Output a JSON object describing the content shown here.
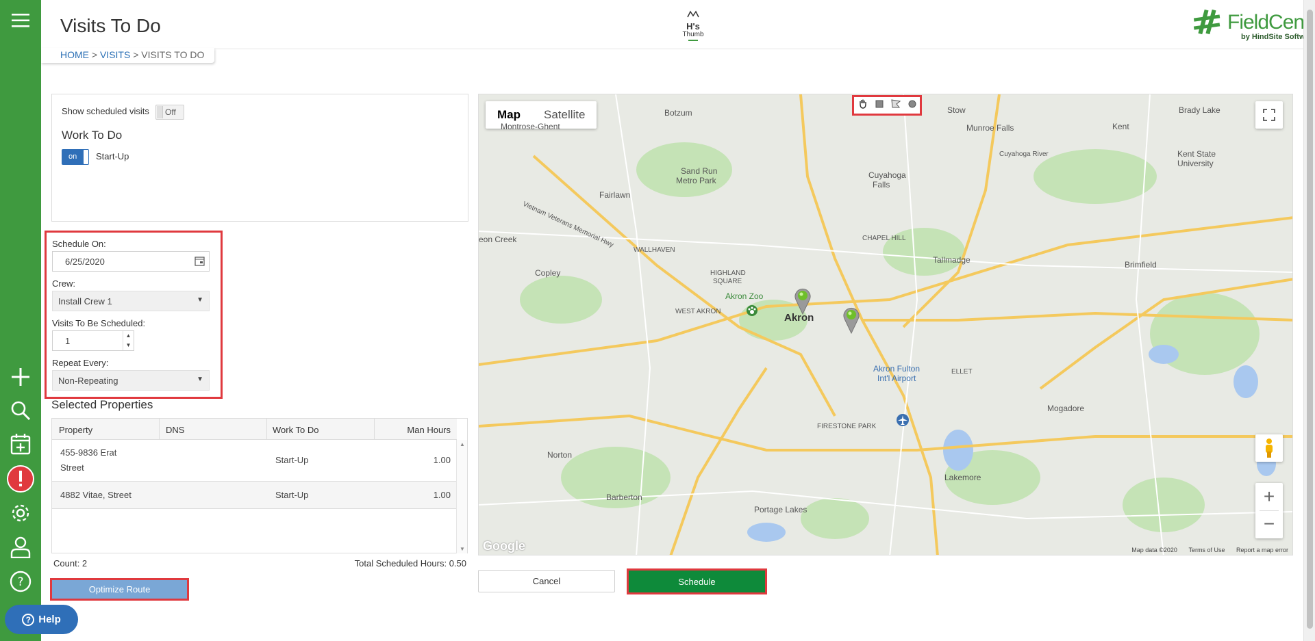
{
  "header": {
    "title": "Visits To Do",
    "breadcrumb": {
      "home": "HOME",
      "visits": "VISITS",
      "current": "VISITS TO DO",
      "sep": ">"
    },
    "center_logo": {
      "line1": "H's",
      "line2": "Thumb"
    },
    "brand": {
      "name": "FieldCentral",
      "sub": "by HindSite Software"
    }
  },
  "sidebar": {
    "icons": [
      "menu-icon",
      "plus-icon",
      "search-icon",
      "calendar-add-icon",
      "alert-icon",
      "gear-icon",
      "user-icon",
      "help-circle-icon"
    ],
    "alert_mark": "!",
    "plus_mark": "+",
    "help_mark": "?"
  },
  "work_panel": {
    "show_scheduled_label": "Show scheduled visits",
    "show_scheduled_toggle": "Off",
    "work_to_do_title": "Work To Do",
    "startup_toggle": "on",
    "startup_label": "Start-Up"
  },
  "schedule_form": {
    "schedule_on_label": "Schedule On:",
    "schedule_on_value": "6/25/2020",
    "crew_label": "Crew:",
    "crew_value": "Install Crew 1",
    "visits_label": "Visits To Be Scheduled:",
    "visits_value": "1",
    "repeat_label": "Repeat Every:",
    "repeat_value": "Non-Repeating"
  },
  "selected_properties": {
    "title": "Selected Properties",
    "columns": [
      "Property",
      "DNS",
      "Work To Do",
      "Man Hours"
    ],
    "rows": [
      {
        "property_line1": "455-9836 Erat",
        "property_line2": "Street",
        "dns": "",
        "work": "Start-Up",
        "hours": "1.00"
      },
      {
        "property_line1": "4882 Vitae, Street",
        "property_line2": "",
        "dns": "",
        "work": "Start-Up",
        "hours": "1.00"
      }
    ],
    "count": "Count: 2",
    "total": "Total Scheduled Hours: 0.50"
  },
  "buttons": {
    "optimize": "Optimize Route",
    "help": "Help",
    "cancel": "Cancel",
    "schedule": "Schedule"
  },
  "map": {
    "type_map": "Map",
    "type_satellite": "Satellite",
    "google": "Google",
    "footer": {
      "data": "Map data ©2020",
      "terms": "Terms of Use",
      "report": "Report a map error"
    },
    "zoom_in": "+",
    "zoom_out": "−",
    "labels": {
      "botzum": "Botzum",
      "montrose": "Montrose-Ghent",
      "stow": "Stow",
      "brady": "Brady Lake",
      "kent": "Kent",
      "munroe": "Munroe Falls",
      "kentstate1": "Kent State",
      "kentstate2": "University",
      "sandrun1": "Sand Run",
      "sandrun2": "Metro Park",
      "cuyahoga1": "Cuyahoga",
      "cuyahoga2": "Falls",
      "fairlawn": "Fairlawn",
      "vietnam": "Vietnam Veterans Memorial Hwy",
      "cuyriver": "Cuyahoga River",
      "eoncreek": "eon Creek",
      "copley": "Copley",
      "wallhaven": "WALLHAVEN",
      "chapel": "CHAPEL HILL",
      "tallmadge": "Tallmadge",
      "brimfield": "Brimfield",
      "highland1": "HIGHLAND",
      "highland2": "SQUARE",
      "akronzoo": "Akron Zoo",
      "westakron": "WEST AKRON",
      "akron": "Akron",
      "fulton1": "Akron Fulton",
      "fulton2": "Int'l Airport",
      "ellet": "ELLET",
      "mogadore": "Mogadore",
      "firestone": "FIRESTONE PARK",
      "norton": "Norton",
      "barberton": "Barberton",
      "portage": "Portage Lakes",
      "lakemore": "Lakemore"
    }
  }
}
